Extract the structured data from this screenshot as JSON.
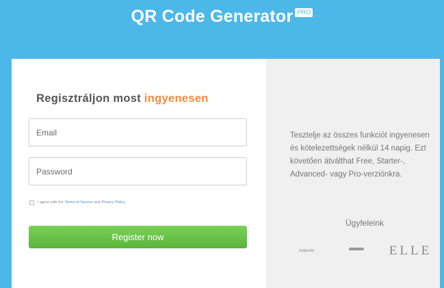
{
  "header": {
    "title": "QR Code Generator",
    "badge": "PRO"
  },
  "form": {
    "title_main": "Regisztráljon most",
    "title_accent": "ingyenesen",
    "email_placeholder": "Email",
    "password_placeholder": "Password",
    "agree_prefix": "I agree with the",
    "terms_link": "Terms of Service",
    "agree_and": "and",
    "privacy_link": "Privacy Policy",
    "register_label": "Register now"
  },
  "info": {
    "description": "Tesztelje az összes funkciót ingyenesen és kötelezettségek nélkül 14 napig. Ezt követően átválthat Free, Starter-, Advanced- vagy Pro-verziónkra.",
    "clients_title": "Ügyfeleink",
    "clients": [
      {
        "name": "zalando",
        "icon": "zalando-logo"
      },
      {
        "name": "",
        "icon": "client-logo-2"
      },
      {
        "name": "ELLE",
        "icon": "elle-logo"
      },
      {
        "name": "",
        "icon": "client-logo-4"
      },
      {
        "name": "",
        "icon": "client-logo-5"
      },
      {
        "name": "",
        "icon": "client-logo-6"
      }
    ]
  },
  "colors": {
    "header": "#4cb8ea",
    "accent": "#f58a3c",
    "button": "#5ab43a",
    "info_panel": "#f0f0f0"
  }
}
